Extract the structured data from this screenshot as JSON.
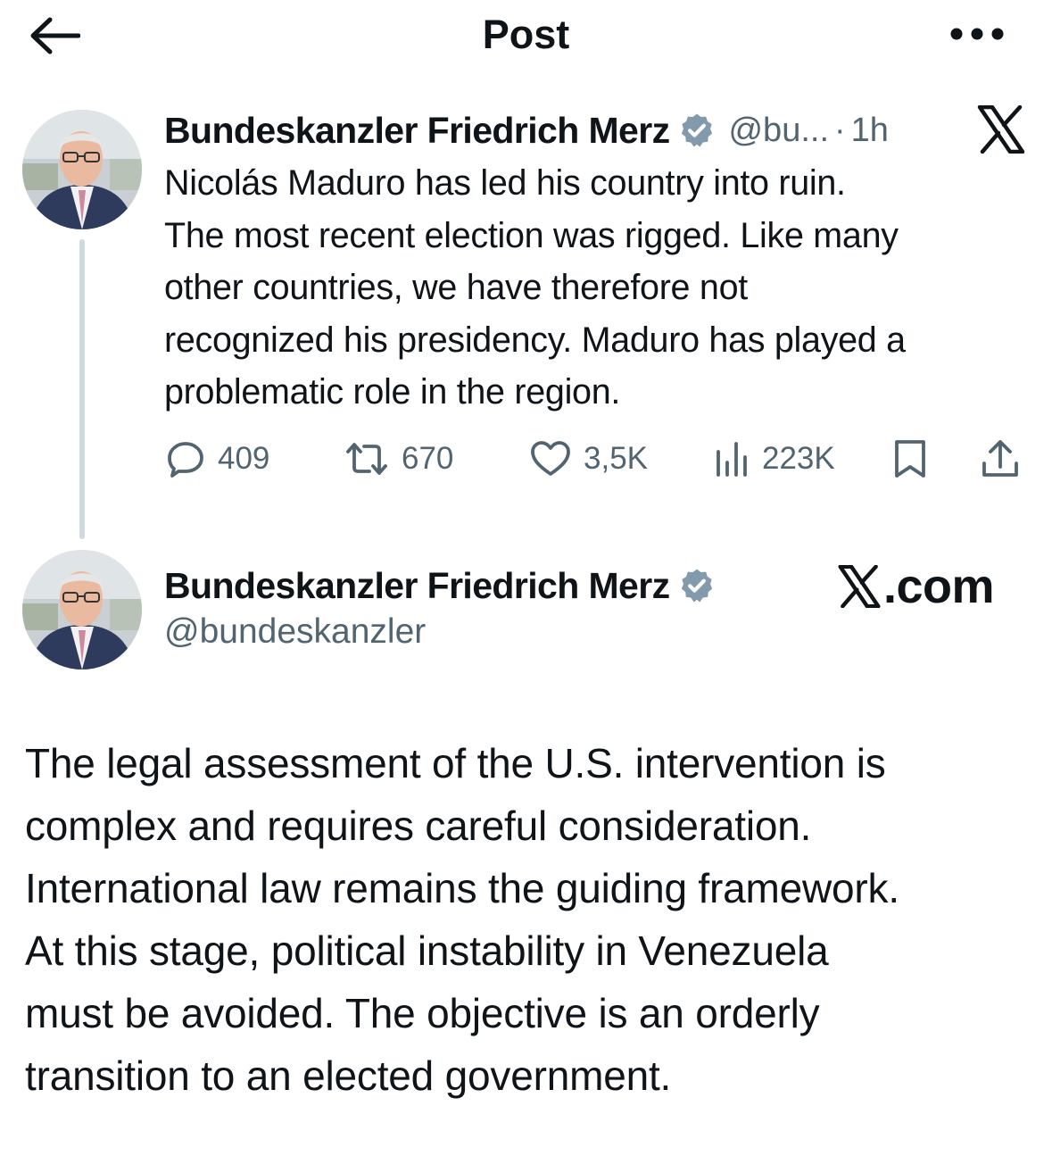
{
  "header": {
    "title": "Post",
    "back_icon": "arrow-left-icon",
    "more_icon": "more-horizontal-icon"
  },
  "tweet1": {
    "author_name": "Bundeskanzler Friedrich Merz",
    "handle_short": "@bu...",
    "separator": "·",
    "time": "1h",
    "text": "Nicolás Maduro has led his country into ruin.\nThe most recent election was rigged. Like many\nother countries, we have therefore not\nrecognized his presidency. Maduro has played a\nproblematic role in the region.",
    "actions": {
      "replies": "409",
      "reposts": "670",
      "likes": "3,5K",
      "views": "223K"
    },
    "colors": {
      "text_secondary": "#536471",
      "verified": "#829aab"
    }
  },
  "tweet2": {
    "author_name": "Bundeskanzler Friedrich Merz",
    "handle": "@bundeskanzler",
    "brand_suffix": ".com",
    "text": "The legal assessment of the U.S. intervention is\ncomplex and requires careful consideration.\nInternational law remains the guiding framework.\nAt this stage, political instability in Venezuela\nmust be avoided. The objective is an orderly\ntransition to an elected government."
  }
}
